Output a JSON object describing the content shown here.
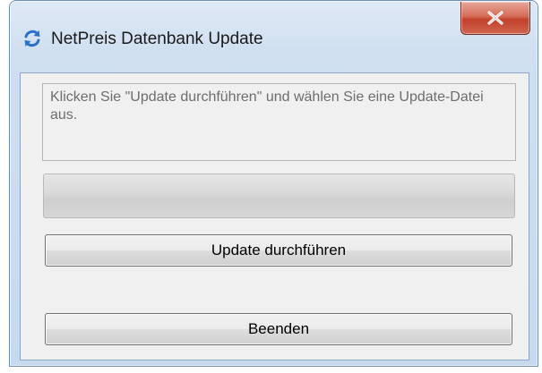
{
  "window": {
    "title": "NetPreis Datenbank Update",
    "title_icon": "refresh-icon",
    "close_icon": "close-icon"
  },
  "message": {
    "text": "Klicken Sie \"Update durchführen\" und wählen Sie eine Update-Datei aus."
  },
  "progress": {
    "value": 0
  },
  "buttons": {
    "update_label": "Update durchführen",
    "exit_label": "Beenden"
  },
  "colors": {
    "title_icon": "#2a6fc9",
    "close_button": "#c7432e",
    "progress_fill": "#2fb24a"
  }
}
